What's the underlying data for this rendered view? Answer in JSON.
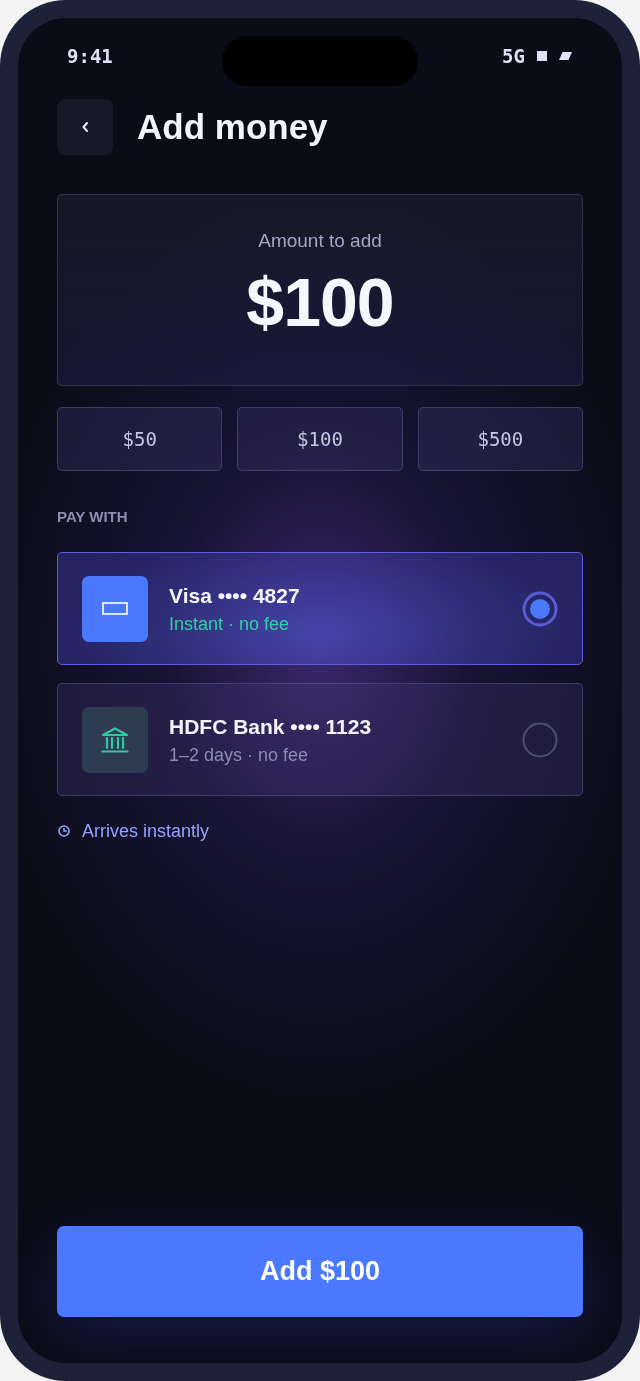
{
  "status_bar": {
    "time": "9:41",
    "network": "5G"
  },
  "header": {
    "title": "Add money"
  },
  "amount": {
    "label": "Amount to add",
    "value": "$100"
  },
  "presets": [
    "$50",
    "$100",
    "$500"
  ],
  "pay_with": {
    "heading": "PAY WITH",
    "methods": [
      {
        "kind": "card",
        "name": "Visa •••• 4827",
        "detail": "Instant · no fee",
        "selected": true
      },
      {
        "kind": "bank",
        "name": "HDFC Bank •••• 1123",
        "detail": "1–2 days · no fee",
        "selected": false
      }
    ]
  },
  "note": "Arrives instantly",
  "submit": {
    "label": "Add $100"
  }
}
